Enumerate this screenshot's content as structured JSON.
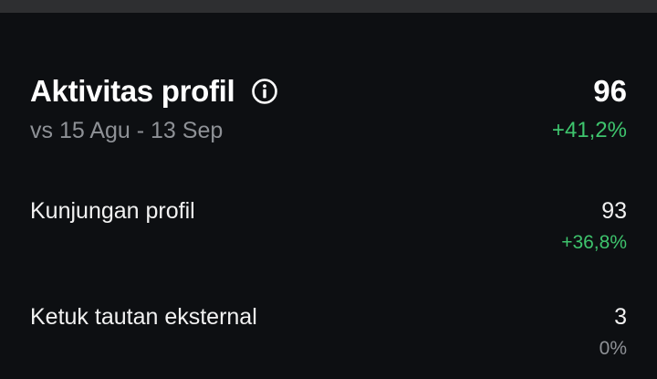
{
  "colors": {
    "background": "#0d0f12",
    "top_strip": "#2e2f31",
    "text_primary": "#ffffff",
    "text_secondary": "#8e9196",
    "positive": "#3ec46d"
  },
  "header": {
    "title": "Aktivitas profil",
    "info_icon": "info-circle-icon",
    "comparison_period": "vs 15 Agu - 13 Sep",
    "total_value": "96",
    "total_change": "+41,2%"
  },
  "metrics": [
    {
      "label": "Kunjungan profil",
      "value": "93",
      "change": "+36,8%",
      "trend": "positive"
    },
    {
      "label": "Ketuk tautan eksternal",
      "value": "3",
      "change": "0%",
      "trend": "neutral"
    }
  ]
}
